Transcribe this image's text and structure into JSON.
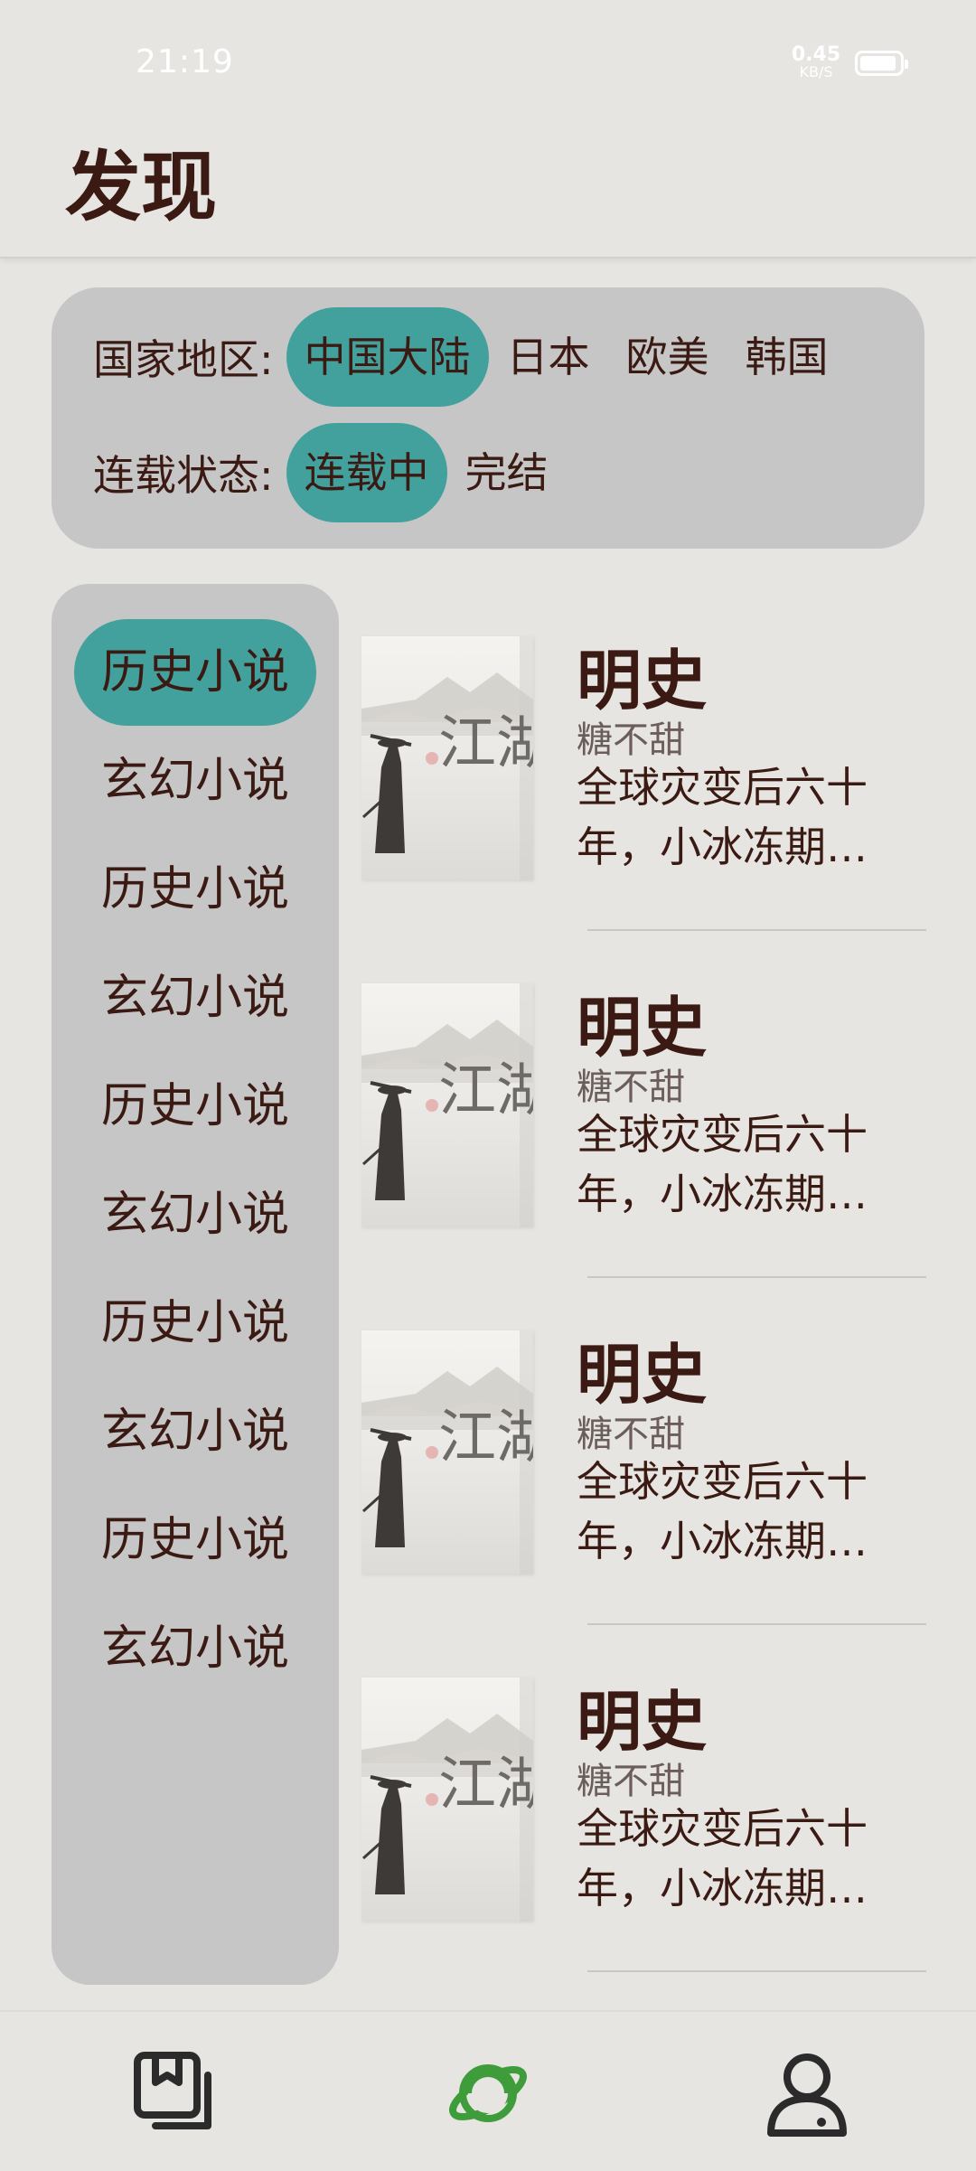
{
  "status": {
    "time": "21:19",
    "speed_value": "0.45",
    "speed_unit": "KB/S"
  },
  "header": {
    "title": "发现"
  },
  "filters": {
    "region_label": "国家地区:",
    "region_options": [
      "中国大陆",
      "日本",
      "欧美",
      "韩国"
    ],
    "region_selected": "中国大陆",
    "status_label": "连载状态:",
    "status_options": [
      "连载中",
      "完结"
    ],
    "status_selected": "连载中"
  },
  "categories": {
    "items": [
      "历史小说",
      "玄幻小说",
      "历史小说",
      "玄幻小说",
      "历史小说",
      "玄幻小说",
      "历史小说",
      "玄幻小说",
      "历史小说",
      "玄幻小说"
    ],
    "selected_index": 0
  },
  "books": [
    {
      "title": "明史",
      "author": "糖不甜",
      "description": "全球灾变后六十年，小冰冻期…",
      "cover_text": "江湖"
    },
    {
      "title": "明史",
      "author": "糖不甜",
      "description": "全球灾变后六十年，小冰冻期…",
      "cover_text": "江湖"
    },
    {
      "title": "明史",
      "author": "糖不甜",
      "description": "全球灾变后六十年，小冰冻期…",
      "cover_text": "江湖"
    },
    {
      "title": "明史",
      "author": "糖不甜",
      "description": "全球灾变后六十年，小冰冻期…",
      "cover_text": "江湖"
    }
  ],
  "bottom_nav": {
    "items": [
      {
        "icon": "bookshelf-icon",
        "active": false
      },
      {
        "icon": "planet-icon",
        "active": true
      },
      {
        "icon": "profile-icon",
        "active": false
      }
    ],
    "active_color": "#3E9C3A",
    "inactive_color": "#2B2B2B"
  },
  "colors": {
    "accent": "#43A19D",
    "background": "#E6E5E2",
    "panel": "#C6C6C7",
    "text": "#3A1A12"
  }
}
